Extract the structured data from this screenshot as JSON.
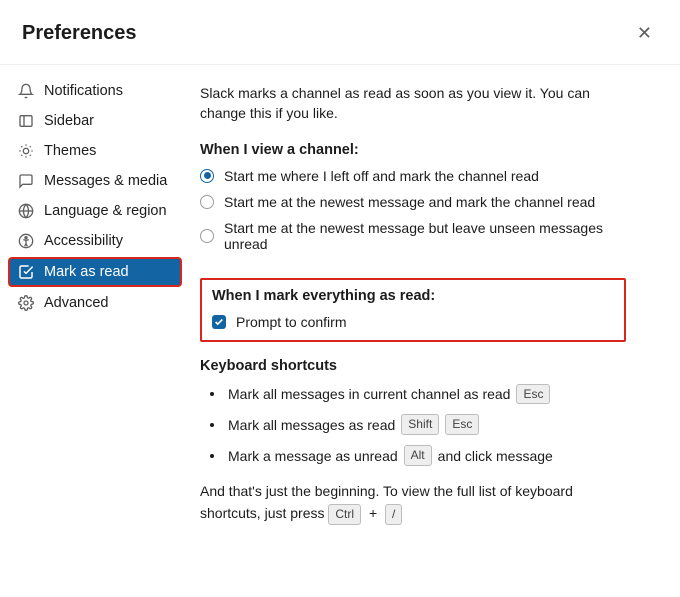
{
  "header": {
    "title": "Preferences"
  },
  "sidebar": {
    "items": [
      {
        "label": "Notifications"
      },
      {
        "label": "Sidebar"
      },
      {
        "label": "Themes"
      },
      {
        "label": "Messages & media"
      },
      {
        "label": "Language & region"
      },
      {
        "label": "Accessibility"
      },
      {
        "label": "Mark as read"
      },
      {
        "label": "Advanced"
      }
    ]
  },
  "content": {
    "intro": "Slack marks a channel as read as soon as you view it. You can change this if you like.",
    "view_channel": {
      "title": "When I view a channel:",
      "options": [
        "Start me where I left off and mark the channel read",
        "Start me at the newest message and mark the channel read",
        "Start me at the newest message but leave unseen messages unread"
      ]
    },
    "mark_all": {
      "title": "When I mark everything as read:",
      "checkbox_label": "Prompt to confirm"
    },
    "shortcuts": {
      "title": "Keyboard shortcuts",
      "items": [
        {
          "text": "Mark all messages in current channel as read",
          "keys": [
            "Esc"
          ]
        },
        {
          "text": "Mark all messages as read",
          "keys": [
            "Shift",
            "Esc"
          ]
        },
        {
          "text_before": "Mark a message as unread",
          "keys": [
            "Alt"
          ],
          "text_after": "and click message"
        }
      ]
    },
    "footer": {
      "text_before": "And that's just the beginning. To view the full list of keyboard shortcuts, just press",
      "keys": [
        "Ctrl",
        "/"
      ]
    }
  }
}
